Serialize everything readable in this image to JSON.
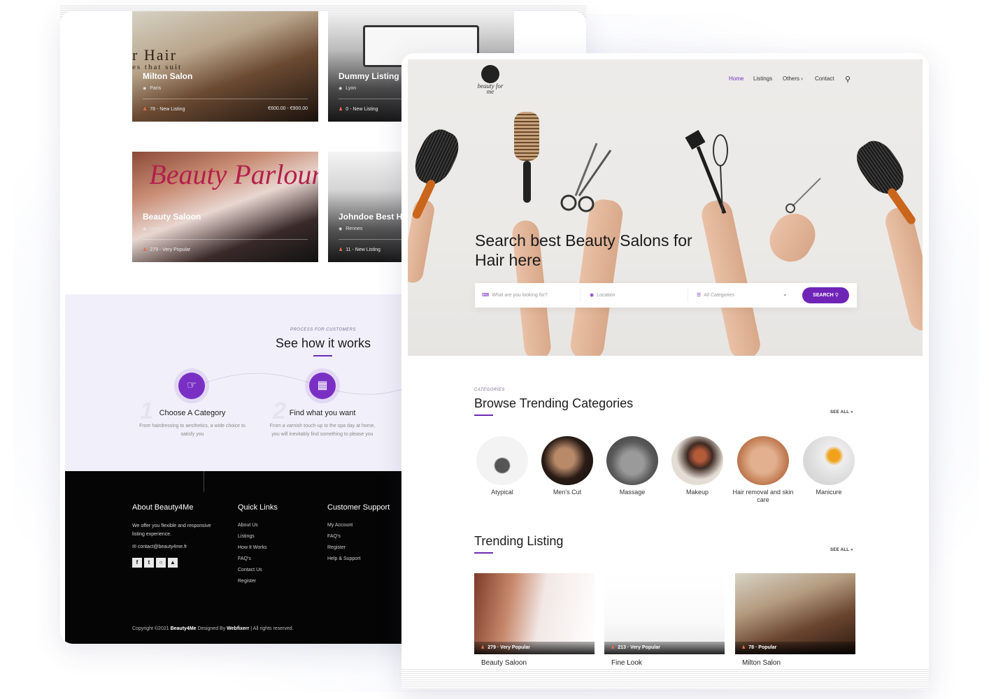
{
  "back_listings": [
    {
      "title": "Milton Salon",
      "location": "Paris",
      "meta": "78 - New Listing",
      "price": "€600.00 - €900.00",
      "bg_text": "r Hair",
      "bg_sub": "es that suit"
    },
    {
      "title": "Dummy Listing",
      "location": "Lyon",
      "meta": "0 - New Listing",
      "price": ""
    },
    {
      "title": "Beauty Saloon",
      "location": "Lyon",
      "meta": "279 - Very Popular",
      "price": "",
      "script": "Beauty Parlour"
    },
    {
      "title": "Johndoe Best Hair",
      "location": "Rennes",
      "meta": "11 - New Listing",
      "price": ""
    }
  ],
  "how": {
    "eyebrow": "PROCESS FOR CUSTOMERS",
    "title": "See how it works",
    "steps": [
      {
        "num": "1",
        "title": "Choose A Category",
        "desc1": "From hairdressing to aesthetics, a wide choice to",
        "desc2": "satisfy you"
      },
      {
        "num": "2",
        "title": "Find what you want",
        "desc1": "From a varnish touch-up to the spa day at home,",
        "desc2": "you will inevitably find something to please you"
      }
    ]
  },
  "footer": {
    "about_title": "About Beauty4Me",
    "about_text": "We offer you flexible and responsive listing experience.",
    "email": "contact@beauty4me.fr",
    "quick_title": "Quick Links",
    "quick_links": [
      "About Us",
      "Listings",
      "How It Works",
      "FAQ's",
      "Contact Us",
      "Register"
    ],
    "support_title": "Customer Support",
    "support_links": [
      "My Account",
      "FAQ's",
      "Register",
      "Help & Support"
    ],
    "copyright_pre": "Copyright ©2021",
    "brand": "Beauty4Me",
    "designed": "Designed By",
    "designer": "Webfixerr",
    "rights": "| All rights reserved."
  },
  "front": {
    "logo": "beauty for me",
    "nav": [
      "Home",
      "Listings",
      "Others ›",
      "Contact"
    ],
    "hero_title_1": "Search best Beauty Salons for",
    "hero_title_2": "Hair here",
    "search": {
      "keyword_placeholder": "What are you looking for?",
      "location_placeholder": "Location",
      "category_selected": "All Categories",
      "button": "SEARCH"
    },
    "categories_eyebrow": "CATEGORIES",
    "categories_title": "Browse Trending Categories",
    "see_all": "SEE ALL »",
    "categories": [
      "Atypical",
      "Men's Cut",
      "Massage",
      "Makeup",
      "Hair removal and skin care",
      "Manicure"
    ],
    "trending_title": "Trending Listing",
    "trending": [
      {
        "meta": "279 · Very Popular",
        "name": "Beauty Saloon"
      },
      {
        "meta": "213 · Very Popular",
        "name": "Fine Look"
      },
      {
        "meta": "78 · Popular",
        "name": "Milton Salon"
      }
    ]
  },
  "colors": {
    "accent": "#6f24b8",
    "footer_bg": "#050505",
    "how_bg": "#f1f0fa"
  }
}
